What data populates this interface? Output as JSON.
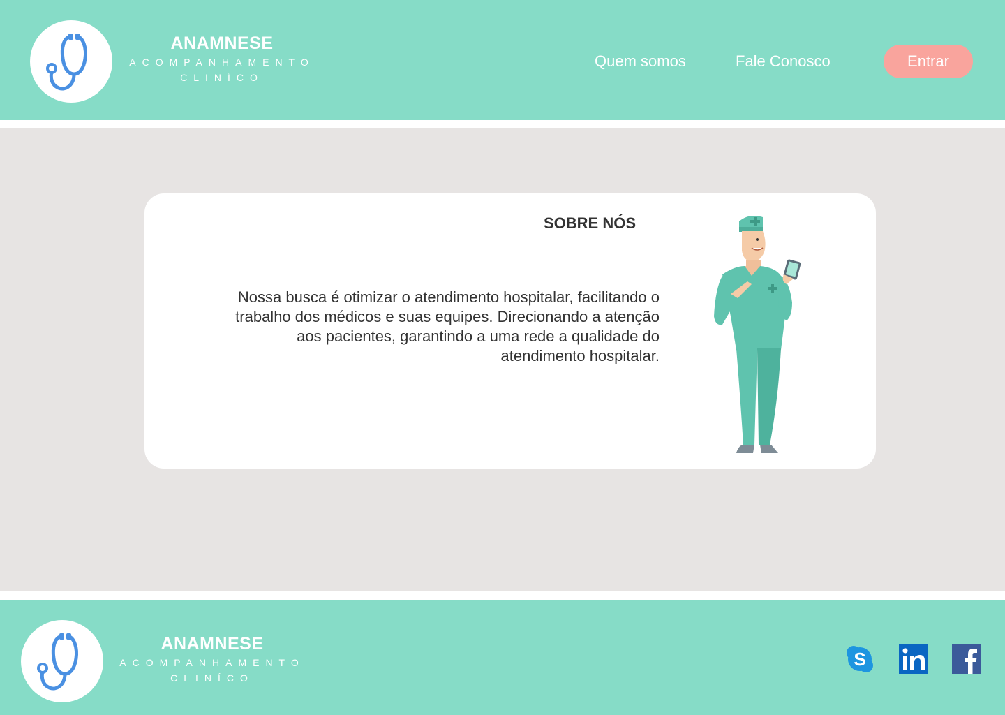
{
  "header": {
    "brand_name": "ANAMNESE",
    "brand_tag_line1": "ACOMPANHAMENTO",
    "brand_tag_line2": "CLINÍCO",
    "nav": [
      {
        "label": "Quem somos"
      },
      {
        "label": "Fale Conosco"
      }
    ],
    "login_label": "Entrar"
  },
  "about": {
    "title": "SOBRE NÓS",
    "text": "Nossa busca é otimizar o atendimento hospitalar, facilitando o\ntrabalho dos médicos e suas equipes. Direcionando a atenção\naos pacientes,  garantindo a uma rede  a qualidade do\natendimento hospitalar."
  },
  "footer": {
    "brand_name": "ANAMNESE",
    "brand_tag_line1": "ACOMPANHAMENTO",
    "brand_tag_line2": "CLINÍCO",
    "social": [
      "skype-icon",
      "linkedin-icon",
      "facebook-icon"
    ]
  },
  "colors": {
    "band": "#86dcc7",
    "background": "#e7e4e3",
    "button": "#f9a49d",
    "stethoscope": "#4a90e2",
    "scrubs": "#5fc3ae"
  }
}
